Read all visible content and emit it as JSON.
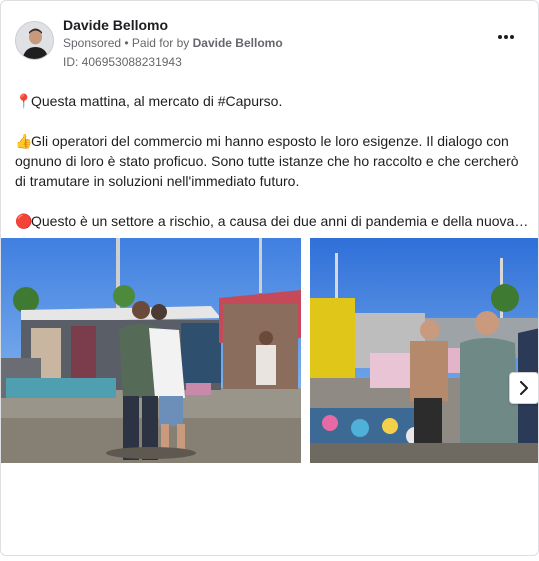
{
  "advertiser": {
    "name": "Davide Bellomo",
    "sponsored_label": "Sponsored",
    "separator": " • ",
    "paid_for_by_label": "Paid for by ",
    "paid_for_by_name": "Davide Bellomo",
    "ad_id": "ID: 406953088231943"
  },
  "post": {
    "paragraphs": [
      {
        "emoji": "📍",
        "lines": [
          "Questa mattina, al mercato di #Capurso."
        ]
      },
      {
        "emoji": "👍",
        "lines": [
          "Gli operatori del commercio mi hanno esposto le loro esigenze. Il dialogo con",
          "ognuno di loro è stato proficuo. Sono tutte istanze che ho raccolto e che cercherò",
          "di tramutare in soluzioni nell'immediato futuro."
        ]
      },
      {
        "emoji": "🔴",
        "lines": [
          "Questo è un settore a rischio, a causa dei due anni di pandemia e della nuova…"
        ]
      }
    ]
  },
  "icons": {
    "more": "more-options-icon",
    "next": "chevron-right-icon",
    "pin": "pushpin-emoji",
    "thumb": "thumbs-up-emoji",
    "red_circle": "red-circle-emoji"
  },
  "colors": {
    "text": "#1c1e21",
    "secondary_text": "#65676b",
    "border": "#dddfe2"
  }
}
